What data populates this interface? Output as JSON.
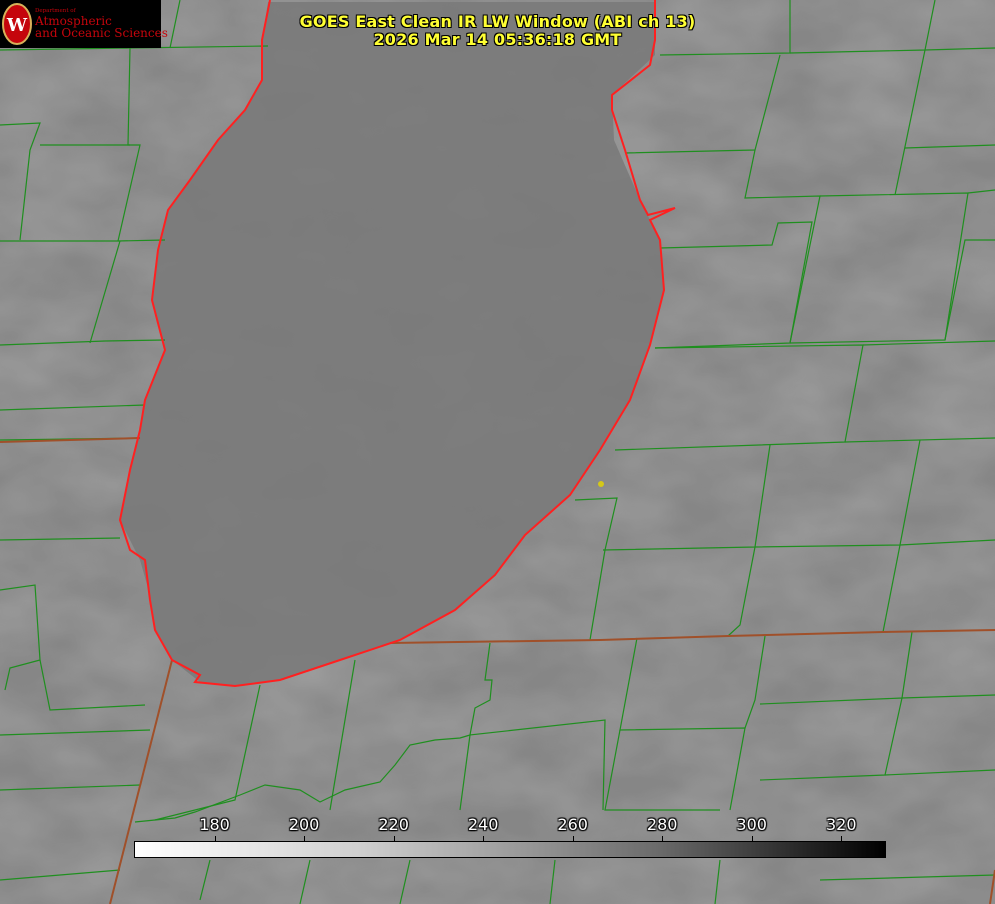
{
  "header": {
    "title": "GOES East Clean IR LW Window (ABI ch 13)",
    "datetime": "2026 Mar 14 05:36:18 GMT"
  },
  "logo": {
    "department": "Department of",
    "line1": "Atmospheric",
    "line2": "and Oceanic Sciences",
    "crest_letter": "W",
    "color": "#c5050c"
  },
  "colorbar": {
    "min": 162,
    "max": 330,
    "ticks": [
      "180",
      "200",
      "220",
      "240",
      "260",
      "280",
      "300",
      "320"
    ],
    "colormap": "white-to-black (grayscale, inverted)"
  },
  "map": {
    "background": "#8a8a8a",
    "lake_fill": "#7b7b7b",
    "county_line_color": "#1a8a1a",
    "state_line_color": "#a0522d",
    "coastline_color": "#ff1a1a",
    "station_marker_color": "#d4c818"
  }
}
